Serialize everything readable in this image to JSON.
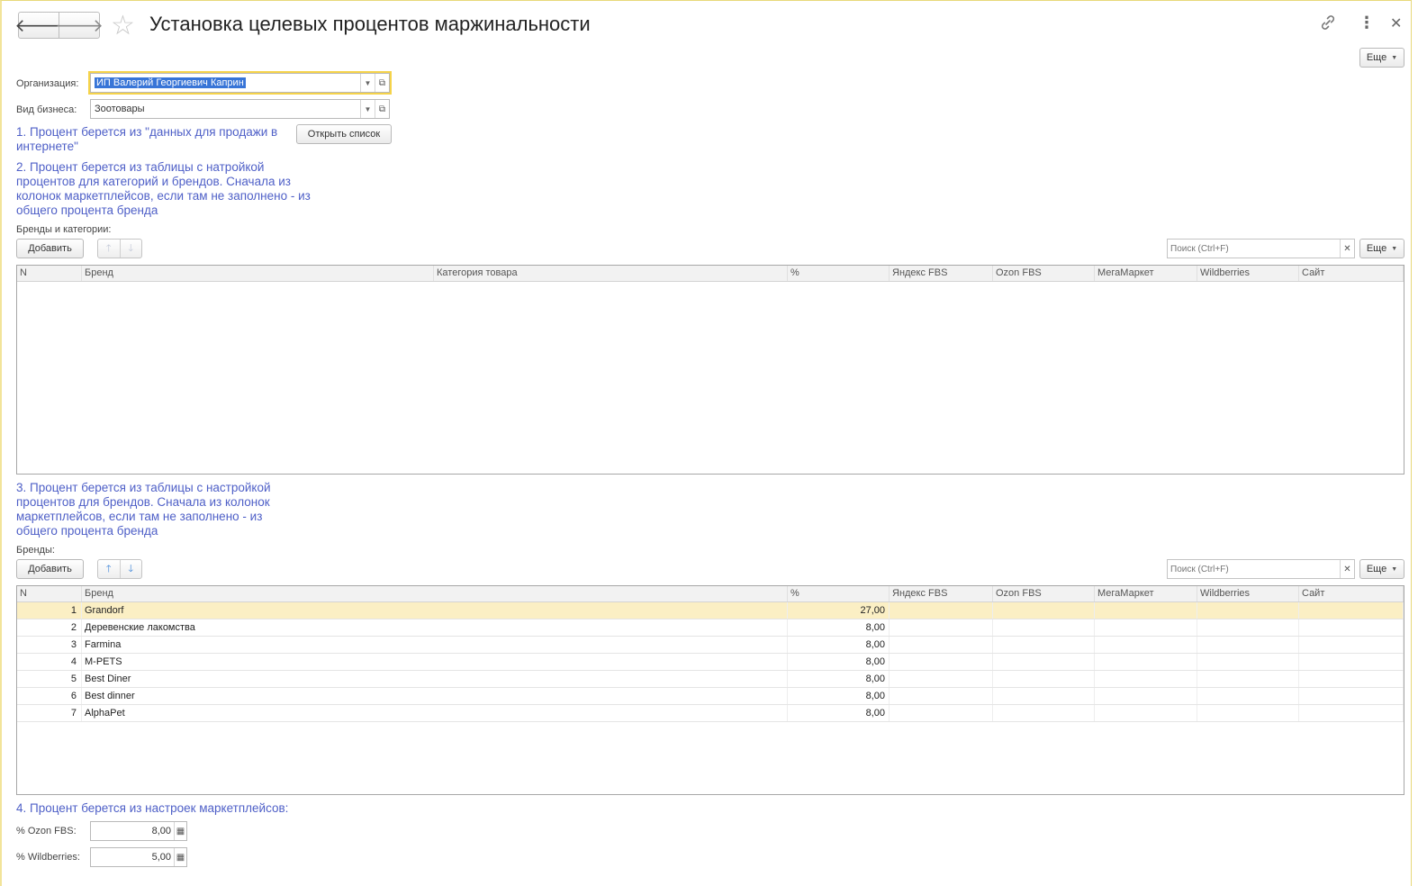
{
  "header": {
    "title": "Установка целевых процентов маржинальности",
    "more_label": "Еще"
  },
  "form": {
    "organization_label": "Организация:",
    "organization_value": "ИП Валерий Георгиевич Каприн",
    "business_label": "Вид бизнеса:",
    "business_value": "Зоотовары",
    "open_list_label": "Открыть список"
  },
  "notes": {
    "n1": "1. Процент берется из \"данных для продажи в интернете\"",
    "n2": "2. Процент берется из таблицы с натройкой процентов для категорий и брендов. Сначала из колонок маркетплейсов, если там не заполнено - из общего процента бренда",
    "n3": "3. Процент берется из таблицы с настройкой процентов для брендов. Сначала из колонок маркетплейсов, если там не заполнено - из общего процента бренда",
    "n4": "4. Процент берется из настроек маркетплейсов:"
  },
  "brands_categories": {
    "section_label": "Бренды и категории:",
    "add_label": "Добавить",
    "search_placeholder": "Поиск (Ctrl+F)",
    "more_label": "Еще",
    "columns": [
      "N",
      "Бренд",
      "Категория товара",
      "%",
      "Яндекс FBS",
      "Ozon FBS",
      "МегаМаркет",
      "Wildberries",
      "Сайт"
    ]
  },
  "brands": {
    "section_label": "Бренды:",
    "add_label": "Добавить",
    "search_placeholder": "Поиск (Ctrl+F)",
    "more_label": "Еще",
    "columns": [
      "N",
      "Бренд",
      "%",
      "Яндекс FBS",
      "Ozon FBS",
      "МегаМаркет",
      "Wildberries",
      "Сайт"
    ],
    "rows": [
      {
        "n": "1",
        "brand": "Grandorf",
        "pct": "27,00"
      },
      {
        "n": "2",
        "brand": "Деревенские лакомства",
        "pct": "8,00"
      },
      {
        "n": "3",
        "brand": "Farmina",
        "pct": "8,00"
      },
      {
        "n": "4",
        "brand": "M-PETS",
        "pct": "8,00"
      },
      {
        "n": "5",
        "brand": "Best Diner",
        "pct": "8,00"
      },
      {
        "n": "6",
        "brand": "Best dinner",
        "pct": "8,00"
      },
      {
        "n": "7",
        "brand": "AlphaPet",
        "pct": "8,00"
      }
    ]
  },
  "marketplace": {
    "ozon_label": "% Ozon FBS:",
    "ozon_value": "8,00",
    "wb_label": "% Wildberries:",
    "wb_value": "5,00"
  }
}
